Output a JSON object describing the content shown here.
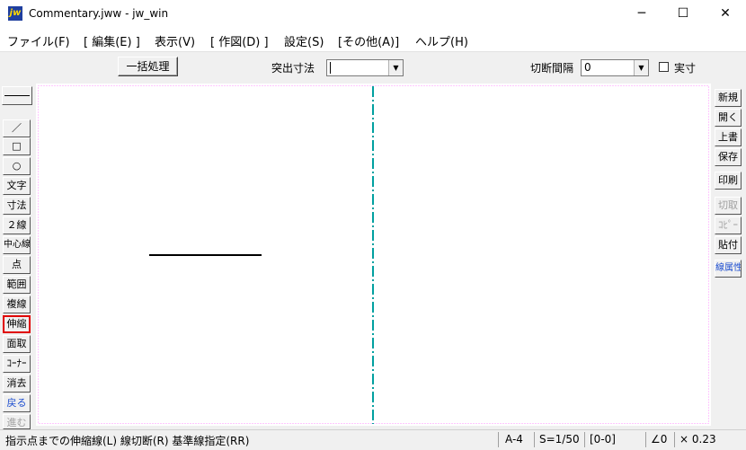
{
  "window": {
    "app_icon_text": "jw",
    "title": "Commentary.jww - jw_win",
    "minimize": "─",
    "maximize": "☐",
    "close": "✕"
  },
  "menu": [
    {
      "label": "ファイル(F)"
    },
    {
      "label": "[ 編集(E) ]"
    },
    {
      "label": "表示(V)"
    },
    {
      "label": "[ 作図(D) ]"
    },
    {
      "label": "設定(S)"
    },
    {
      "label": "[その他(A)]"
    },
    {
      "label": "ヘルプ(H)"
    }
  ],
  "toolbar": {
    "batch_button": "一括処理",
    "overhang_label": "突出寸法",
    "overhang_value": "",
    "gap_label": "切断間隔",
    "gap_value": "0",
    "actual_label": "実寸",
    "actual_checked": false
  },
  "left_tools": [
    {
      "id": "line-style",
      "label": ""
    },
    {
      "id": "line",
      "label": "／"
    },
    {
      "id": "rect",
      "label": "□"
    },
    {
      "id": "circle",
      "label": "○"
    },
    {
      "id": "text",
      "label": "文字"
    },
    {
      "id": "dimension",
      "label": "寸法"
    },
    {
      "id": "double-line",
      "label": "２線"
    },
    {
      "id": "center-line",
      "label": "中心線"
    },
    {
      "id": "point",
      "label": "点"
    },
    {
      "id": "range",
      "label": "範囲"
    },
    {
      "id": "copy-line",
      "label": "複線"
    },
    {
      "id": "stretch",
      "label": "伸縮",
      "selected": true
    },
    {
      "id": "chamfer",
      "label": "面取"
    },
    {
      "id": "corner",
      "label": "ｺｰﾅｰ"
    },
    {
      "id": "erase",
      "label": "消去"
    },
    {
      "id": "undo",
      "label": "戻る",
      "style": "blue"
    },
    {
      "id": "redo",
      "label": "進む",
      "style": "gray"
    }
  ],
  "right_tools": [
    {
      "id": "new",
      "label": "新規"
    },
    {
      "id": "open",
      "label": "開く"
    },
    {
      "id": "overwrite",
      "label": "上書"
    },
    {
      "id": "save",
      "label": "保存"
    },
    {
      "id": "print",
      "label": "印刷"
    },
    {
      "id": "cut",
      "label": "切取",
      "style": "gray"
    },
    {
      "id": "copy",
      "label": "ｺﾋﾟｰ",
      "style": "gray"
    },
    {
      "id": "paste",
      "label": "貼付"
    },
    {
      "id": "line-attr",
      "label": "線属性",
      "style": "blue"
    }
  ],
  "status": {
    "message": "指示点までの伸縮線(L) 線切断(R) 基準線指定(RR)",
    "paper": "A-4",
    "scale": "S=1/50",
    "layer": "[0-0]",
    "angle": "∠0",
    "zoom": "× 0.23"
  },
  "colors": {
    "canvas_border": "#ff90ff",
    "center_line": "#00a0a0",
    "drawn_line": "#000000",
    "selected_tool_border": "#e00000"
  }
}
